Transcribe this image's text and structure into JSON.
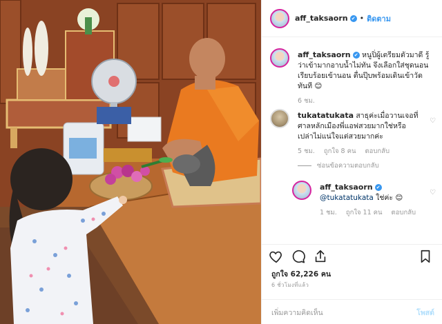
{
  "post": {
    "username": "aff_taksaorn",
    "verified": "✔",
    "separator": "•",
    "follow_label": "ติดตาม",
    "photo_icon": "photo-of-child-offering-flowers-to-monk"
  },
  "comments": [
    {
      "username": "aff_taksaorn",
      "text": "หนูปิ่ผู้เตรียมตัวมาดี รู้ว่าเข้ามากอาบน้ำไม่ทัน จึงเลือกใส่ชุดนอนเรียบร้อยเข้านอน ตื่นปุ๊บพร้อมเดินเข้าวัดทันที 😊",
      "time": "6 ชม."
    },
    {
      "username": "tukatatukata",
      "text": "สาธุค่ะเมื่อวานเจอที่ศาลหลักเมืองพี่แอฟสวยมากใช่หรือเปล่าไม่แน่ใจแต่สวยมากค่ะ",
      "time": "5 ชม.",
      "likes": "ถูกใจ 8 คน",
      "reply": "ตอบกลับ",
      "hide_replies": "ซ่อนข้อความตอบกลับ"
    },
    {
      "username": "aff_taksaorn",
      "mention": "@tukatatukata",
      "text": " ใช่ค่ะ 😊",
      "time": "1 ชม.",
      "likes": "ถูกใจ 11 คน",
      "reply": "ตอบกลับ"
    }
  ],
  "actions": {
    "like_icon": "heart-icon",
    "comment_icon": "comment-icon",
    "share_icon": "share-icon",
    "save_icon": "bookmark-icon",
    "likes_text": "ถูกใจ 62,226 คน",
    "timestamp": "6 ชั่วโมงที่แล้ว"
  },
  "add_comment": {
    "placeholder": "เพิ่มความคิดเห็น",
    "post_label": "โพสต์"
  }
}
